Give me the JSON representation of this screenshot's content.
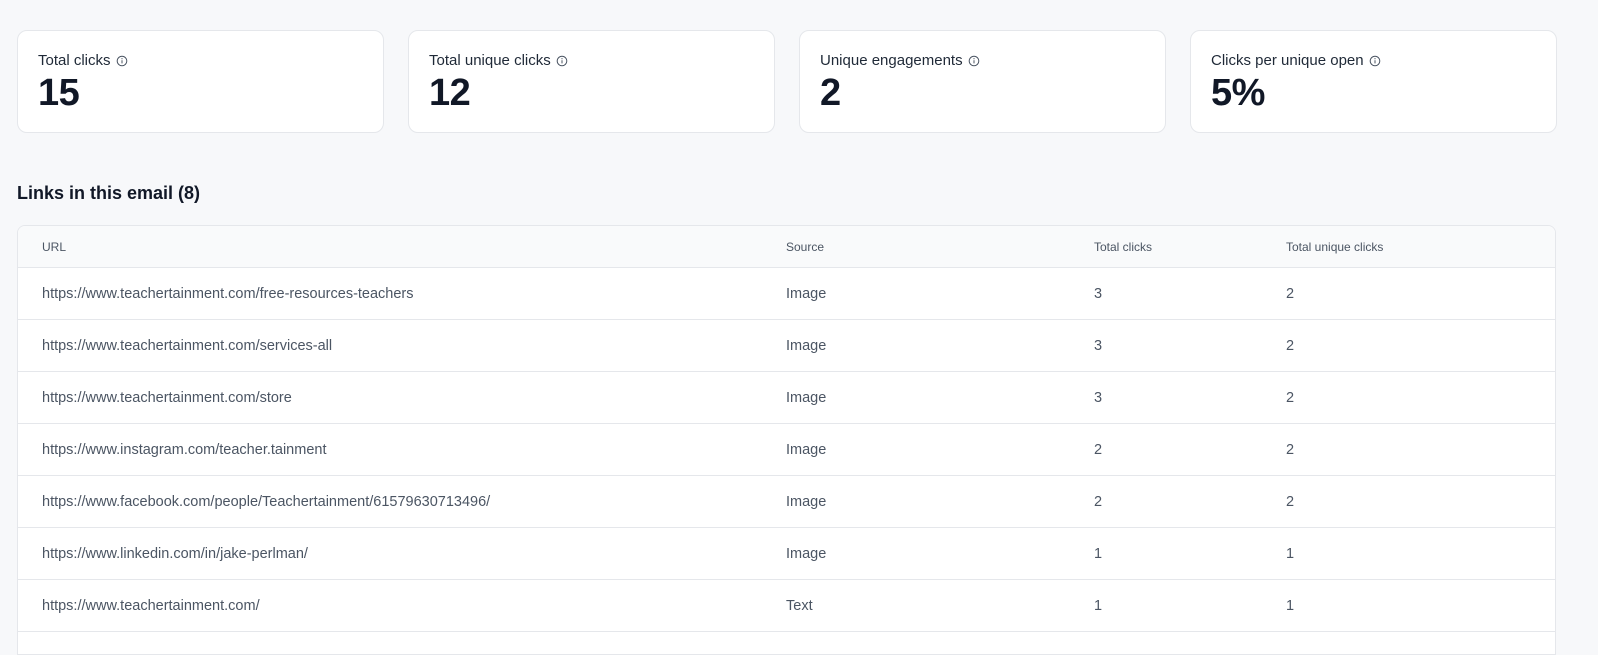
{
  "stats": [
    {
      "label": "Total clicks",
      "value": "15"
    },
    {
      "label": "Total unique clicks",
      "value": "12"
    },
    {
      "label": "Unique engagements",
      "value": "2"
    },
    {
      "label": "Clicks per unique open",
      "value": "5%"
    }
  ],
  "links_section": {
    "title": "Links in this email (8)",
    "columns": {
      "url": "URL",
      "source": "Source",
      "total_clicks": "Total clicks",
      "total_unique_clicks": "Total unique clicks"
    },
    "rows": [
      {
        "url": "https://www.teachertainment.com/free-resources-teachers",
        "source": "Image",
        "total_clicks": "3",
        "total_unique_clicks": "2"
      },
      {
        "url": "https://www.teachertainment.com/services-all",
        "source": "Image",
        "total_clicks": "3",
        "total_unique_clicks": "2"
      },
      {
        "url": "https://www.teachertainment.com/store",
        "source": "Image",
        "total_clicks": "3",
        "total_unique_clicks": "2"
      },
      {
        "url": "https://www.instagram.com/teacher.tainment",
        "source": "Image",
        "total_clicks": "2",
        "total_unique_clicks": "2"
      },
      {
        "url": "https://www.facebook.com/people/Teachertainment/61579630713496/",
        "source": "Image",
        "total_clicks": "2",
        "total_unique_clicks": "2"
      },
      {
        "url": "https://www.linkedin.com/in/jake-perlman/",
        "source": "Image",
        "total_clicks": "1",
        "total_unique_clicks": "1"
      },
      {
        "url": "https://www.teachertainment.com/",
        "source": "Text",
        "total_clicks": "1",
        "total_unique_clicks": "1"
      }
    ]
  },
  "icons": {
    "info": "info-icon"
  },
  "colors": {
    "background": "#f7f8fa",
    "card": "#ffffff",
    "border": "#e5e7eb",
    "text_primary": "#111827",
    "text_secondary": "#4b5563"
  }
}
